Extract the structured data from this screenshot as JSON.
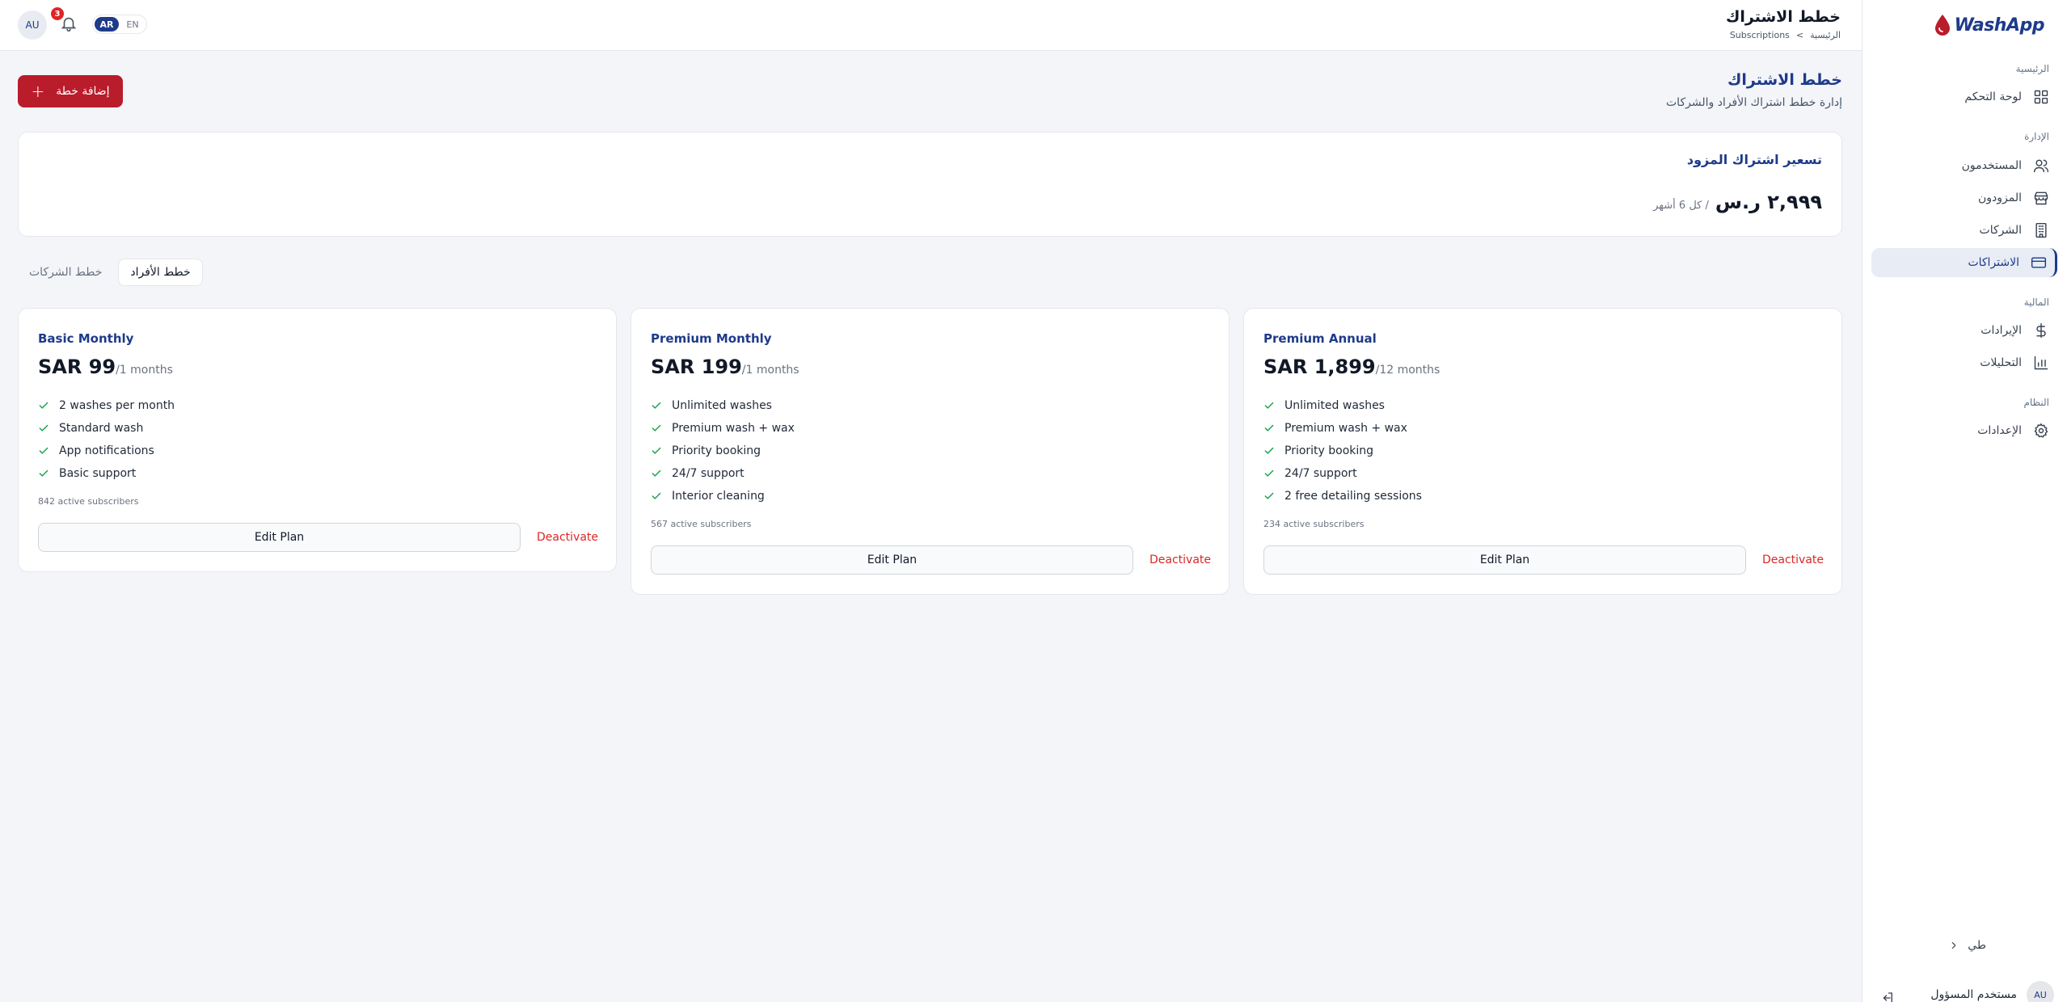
{
  "brand": {
    "logo_text": "WashApp"
  },
  "topbar": {
    "title": "خطط الاشتراك",
    "breadcrumb": [
      "الرئيسية",
      ">",
      "Subscriptions"
    ],
    "avatar_initials": "AU",
    "notification_count": "3",
    "lang": {
      "active": "AR",
      "other": "EN"
    }
  },
  "sidebar": {
    "sections": [
      {
        "label": "الرئيسية",
        "items": [
          {
            "label": "لوحة التحكم",
            "icon": "dashboard-icon"
          }
        ]
      },
      {
        "label": "الإدارة",
        "items": [
          {
            "label": "المستخدمون",
            "icon": "users-icon"
          },
          {
            "label": "المزودون",
            "icon": "store-icon"
          },
          {
            "label": "الشركات",
            "icon": "building-icon"
          },
          {
            "label": "الاشتراكات",
            "icon": "card-icon",
            "active": true
          }
        ]
      },
      {
        "label": "المالية",
        "items": [
          {
            "label": "الإيرادات",
            "icon": "dollar-icon"
          },
          {
            "label": "التحليلات",
            "icon": "chart-icon"
          }
        ]
      },
      {
        "label": "النظام",
        "items": [
          {
            "label": "الإعدادات",
            "icon": "gear-icon"
          }
        ]
      }
    ],
    "collapse_label": "طي",
    "user_name": "مستخدم المسؤول",
    "user_initials": "AU"
  },
  "main": {
    "title": "خطط الاشتراك",
    "subtitle": "إدارة خطط اشتراك الأفراد والشركات",
    "add_button": "إضافة خطة",
    "provider_pricing": {
      "title": "تسعير اشتراك المزود",
      "amount": "٢,٩٩٩ ر.س",
      "period": "/ كل 6 أشهر"
    },
    "tabs": [
      {
        "label": "خطط الأفراد",
        "active": true
      },
      {
        "label": "خطط الشركات",
        "active": false
      }
    ],
    "plans": [
      {
        "name": "Basic Monthly",
        "price": "SAR 99",
        "period": "/1 months",
        "features": [
          "2 washes per month",
          "Standard wash",
          "App notifications",
          "Basic support"
        ],
        "subscribers": "842 active subscribers",
        "edit_label": "Edit Plan",
        "deactivate_label": "Deactivate"
      },
      {
        "name": "Premium Monthly",
        "price": "SAR 199",
        "period": "/1 months",
        "features": [
          "Unlimited washes",
          "Premium wash + wax",
          "Priority booking",
          "24/7 support",
          "Interior cleaning"
        ],
        "subscribers": "567 active subscribers",
        "edit_label": "Edit Plan",
        "deactivate_label": "Deactivate"
      },
      {
        "name": "Premium Annual",
        "price": "SAR 1,899",
        "period": "/12 months",
        "features": [
          "Unlimited washes",
          "Premium wash + wax",
          "Priority booking",
          "24/7 support",
          "2 free detailing sessions"
        ],
        "subscribers": "234 active subscribers",
        "edit_label": "Edit Plan",
        "deactivate_label": "Deactivate"
      }
    ]
  },
  "colors": {
    "primary": "#1e3a8a",
    "accent": "#b91c2b",
    "success": "#16a34a",
    "danger": "#dc2626"
  }
}
